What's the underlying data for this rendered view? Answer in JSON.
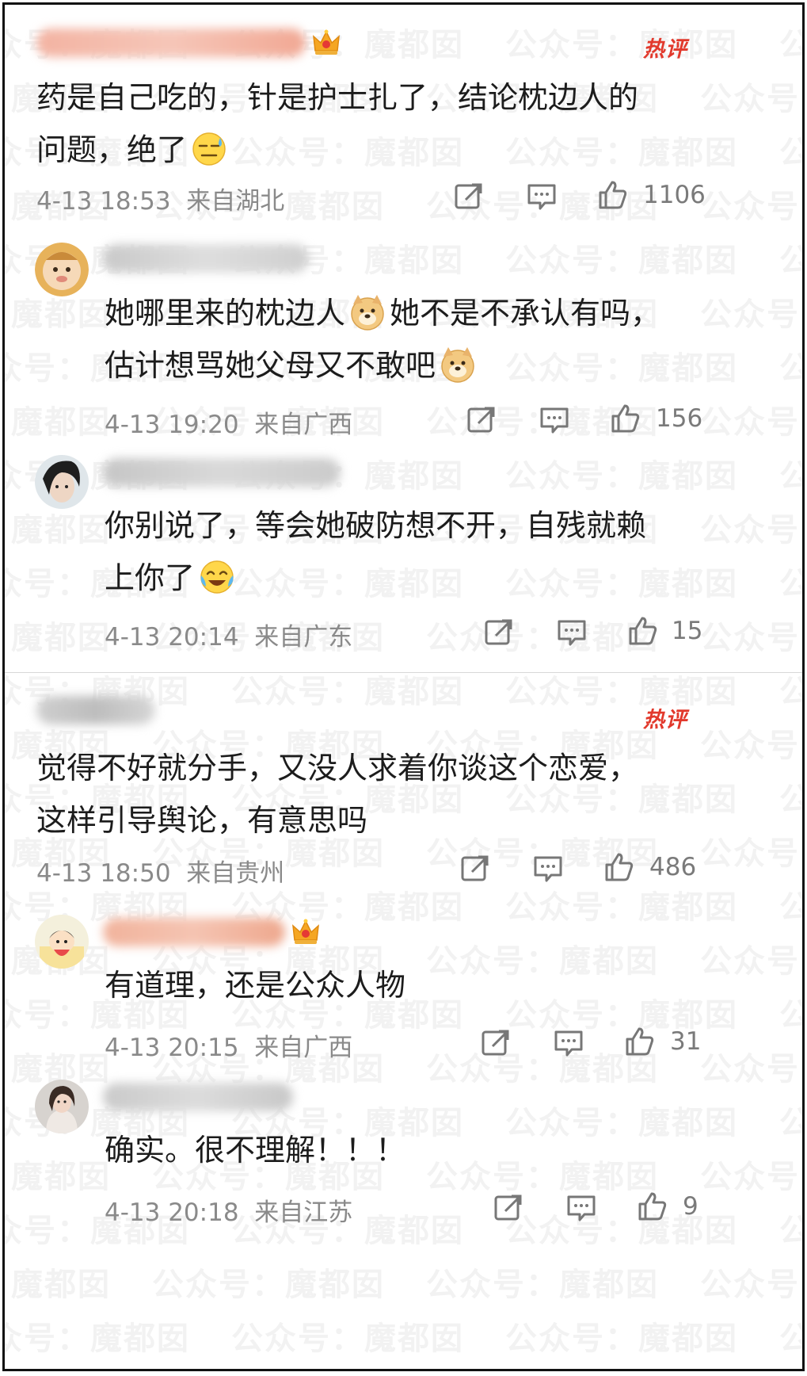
{
  "hot_label": "热评",
  "threads": [
    {
      "comment": {
        "text_lines": [
          "药是自己吃的，针是护士扎了，结论枕边人的",
          "问题，绝了"
        ],
        "emoji": "sweat-smile-emoji",
        "time": "4-13 18:53",
        "location": "来自湖北",
        "likes": "1106"
      },
      "replies": [
        {
          "text_lines": [
            "她哪里来的枕边人",
            "她不是不承认有吗，",
            "估计想骂她父母又不敢吧"
          ],
          "emoji": "doge-emoji",
          "time": "4-13 19:20",
          "location": "来自广西",
          "likes": "156"
        },
        {
          "text_lines": [
            "你别说了，等会她破防想不开，自残就赖",
            "上你了"
          ],
          "emoji": "laugh-cry-emoji",
          "time": "4-13 20:14",
          "location": "来自广东",
          "likes": "15"
        }
      ]
    },
    {
      "comment": {
        "text_lines": [
          "觉得不好就分手，又没人求着你谈这个恋爱，",
          "这样引导舆论，有意思吗"
        ],
        "time": "4-13 18:50",
        "location": "来自贵州",
        "likes": "486"
      },
      "replies": [
        {
          "text_lines": [
            "有道理，还是公众人物"
          ],
          "time": "4-13 20:15",
          "location": "来自广西",
          "likes": "31"
        },
        {
          "text_lines": [
            "确实。很不理解！！！"
          ],
          "time": "4-13 20:18",
          "location": "来自江苏",
          "likes": "9"
        }
      ]
    }
  ],
  "watermark_text": "公众号：魔都囡",
  "colors": {
    "hot": "#e2392c",
    "meta": "#8a8a8a",
    "text": "#1c1c1c"
  }
}
